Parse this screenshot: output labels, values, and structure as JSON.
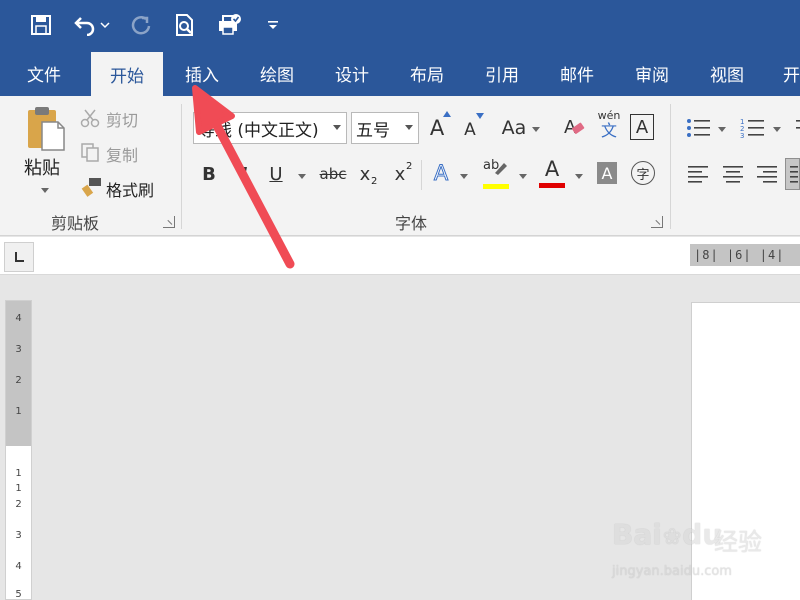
{
  "tabs": [
    "文件",
    "开始",
    "插入",
    "绘图",
    "设计",
    "布局",
    "引用",
    "邮件",
    "审阅",
    "视图",
    "开"
  ],
  "clipboard": {
    "paste_label": "粘贴",
    "cut_label": "剪切",
    "copy_label": "复制",
    "format_painter_label": "格式刷",
    "group_label": "剪贴板"
  },
  "font": {
    "font_name_value": "等线 (中文正文)",
    "font_size_value": "五号",
    "group_label": "字体",
    "grow_label": "A",
    "shrink_label": "A",
    "case_label": "Aa",
    "phonetic_top": "wén",
    "phonetic_bottom": "文",
    "char_border_label": "A",
    "bold_label": "B",
    "italic_label": "I",
    "underline_label": "U",
    "strike_label": "abc",
    "subscript_label": "x",
    "subscript_small": "2",
    "superscript_label": "x",
    "superscript_small": "2",
    "effects_label": "A",
    "highlight_label": "ab",
    "font_color_label": "A",
    "shading_label": "A",
    "enclose_label": "字",
    "highlight_color": "#ffff00",
    "font_color": "#e00000"
  },
  "ruler": {
    "horizontal_marks": "|8|  |6|  |4|",
    "vertical_marks": [
      "4",
      "3",
      "2",
      "1",
      "1",
      "1",
      "2",
      "3",
      "4",
      "5"
    ]
  },
  "watermark": {
    "brand": "Bai",
    "brand_suffix": "du",
    "jingyan": "经验",
    "url": "jingyan.baidu.com"
  },
  "colors": {
    "ribbon_blue": "#2b579a",
    "annotation_arrow": "#f04b55"
  },
  "icons": [
    "save-icon",
    "undo-icon",
    "redo-icon",
    "print-preview-icon",
    "quick-print-icon",
    "customize-qat-icon"
  ]
}
